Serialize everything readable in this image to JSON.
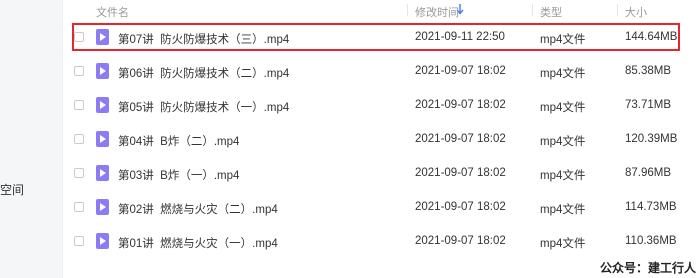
{
  "sidebar": {
    "label": "空间"
  },
  "header": {
    "name": "文件名",
    "modified": "修改时间",
    "type": "类型",
    "size": "大小"
  },
  "files": [
    {
      "name": "第07讲  防火防爆技术（三）.mp4",
      "modified": "2021-09-11 22:50",
      "type": "mp4文件",
      "size": "144.64MB"
    },
    {
      "name": "第06讲  防火防爆技术（二）.mp4",
      "modified": "2021-09-07 18:02",
      "type": "mp4文件",
      "size": "85.38MB"
    },
    {
      "name": "第05讲  防火防爆技术（一）.mp4",
      "modified": "2021-09-07 18:02",
      "type": "mp4文件",
      "size": "73.71MB"
    },
    {
      "name": "第04讲  B炸（二）.mp4",
      "modified": "2021-09-07 18:02",
      "type": "mp4文件",
      "size": "120.39MB"
    },
    {
      "name": "第03讲  B炸（一）.mp4",
      "modified": "2021-09-07 18:02",
      "type": "mp4文件",
      "size": "87.96MB"
    },
    {
      "name": "第02讲  燃烧与火灾（二）.mp4",
      "modified": "2021-09-07 18:02",
      "type": "mp4文件",
      "size": "114.73MB"
    },
    {
      "name": "第01讲  燃烧与火灾（一）.mp4",
      "modified": "2021-09-07 18:02",
      "type": "mp4文件",
      "size": "110.36MB"
    }
  ],
  "watermark": "公众号：建工行人",
  "colors": {
    "highlight": "#e5262b",
    "file_icon": "#8b7cf6"
  }
}
